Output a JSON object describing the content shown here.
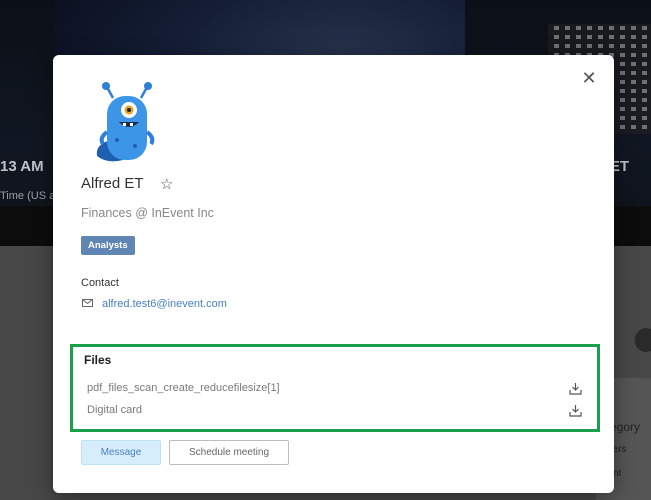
{
  "background": {
    "time_fragment": "13 AM",
    "timezone_fragment": "Time (US a",
    "et_fragment": "ET",
    "category_fragment": "ategory",
    "category_item_1": "ncers",
    "category_item_2": "dent"
  },
  "modal": {
    "close_icon": "close-icon",
    "avatar_icon": "blue-monster-avatar",
    "name": "Alfred ET",
    "favorite_icon": "star-icon",
    "role": "Finances @ InEvent Inc",
    "badge": "Analysts",
    "contact": {
      "heading": "Contact",
      "email_icon": "envelope-icon",
      "email": "alfred.test6@inevent.com"
    },
    "files": {
      "heading": "Files",
      "items": [
        {
          "name": "pdf_files_scan_create_reducefilesize[1]",
          "icon": "download-icon"
        },
        {
          "name": "Digital card",
          "icon": "download-icon"
        }
      ]
    },
    "actions": {
      "message_label": "Message",
      "schedule_label": "Schedule meeting"
    }
  },
  "colors": {
    "highlight_border": "#1aa04a",
    "badge_bg": "#5f86b3",
    "link": "#4a7fc0",
    "message_bg": "#d6eefb"
  }
}
